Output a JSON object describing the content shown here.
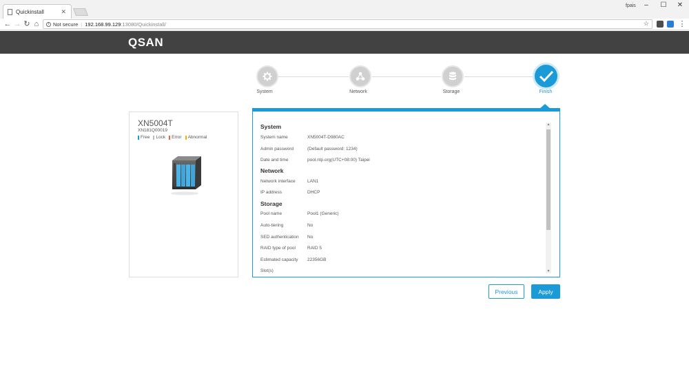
{
  "browser": {
    "tab_title": "Quickinstall",
    "user": "fpais",
    "security_label": "Not secure",
    "url_host": "192.168.99.129",
    "url_path": ":13080/Quickinstall/"
  },
  "app": {
    "logo": "QSAN"
  },
  "steps": [
    {
      "label": "System",
      "icon": "gear-icon",
      "state": "done"
    },
    {
      "label": "Network",
      "icon": "network-icon",
      "state": "done"
    },
    {
      "label": "Storage",
      "icon": "database-icon",
      "state": "done"
    },
    {
      "label": "Finish",
      "icon": "checkmark-icon",
      "state": "active"
    }
  ],
  "device": {
    "model": "XN5004T",
    "serial": "XN181Q00019",
    "legend": [
      {
        "label": "Free",
        "color": "#1a9ad6"
      },
      {
        "label": "Lock",
        "color": "#bbbbbb"
      },
      {
        "label": "Error",
        "color": "#e8643c"
      },
      {
        "label": "Abnormal",
        "color": "#f0b400"
      }
    ]
  },
  "summary": {
    "system": {
      "heading": "System",
      "rows": [
        {
          "key": "System name",
          "value": "XN5004T-D980AC"
        },
        {
          "key": "Admin password",
          "value": "(Default password: 1234)"
        },
        {
          "key": "Date and time",
          "value": "pool.ntp.org(UTC+08:00) Taipei"
        }
      ]
    },
    "network": {
      "heading": "Network",
      "rows": [
        {
          "key": "Network interface",
          "value": "LAN1"
        },
        {
          "key": "IP address",
          "value": "DHCP"
        }
      ]
    },
    "storage": {
      "heading": "Storage",
      "rows": [
        {
          "key": "Pool name",
          "value": "Pool1   (Generic)"
        },
        {
          "key": "Auto-tiering",
          "value": "No"
        },
        {
          "key": "SED authentication",
          "value": "No"
        },
        {
          "key": "RAID type of pool",
          "value": "RAID 5"
        },
        {
          "key": "Estimated capacity",
          "value": "22356GB"
        },
        {
          "key": "Slot(s)",
          "value": ""
        }
      ]
    }
  },
  "buttons": {
    "previous": "Previous",
    "apply": "Apply"
  },
  "colors": {
    "accent": "#1a9ad6",
    "header": "#424242"
  }
}
